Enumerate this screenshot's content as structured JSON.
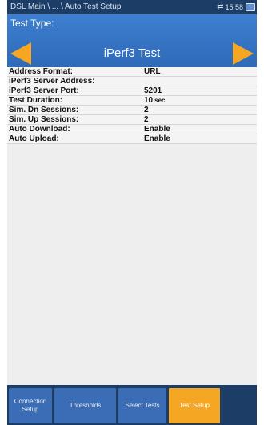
{
  "titlebar": {
    "breadcrumb": "DSL Main \\ ... \\ Auto Test Setup",
    "time": "15:58",
    "icons": [
      "network-arrows-icon",
      "battery-icon"
    ]
  },
  "test_type": {
    "label": "Test Type:",
    "value": "iPerf3 Test"
  },
  "params": [
    {
      "label": "Address Format:",
      "value": "URL",
      "unit": ""
    },
    {
      "label": "iPerf3 Server Address:",
      "value": "",
      "unit": ""
    },
    {
      "label": "iPerf3 Server Port:",
      "value": "5201",
      "unit": ""
    },
    {
      "label": "Test Duration:",
      "value": "10",
      "unit": "sec"
    },
    {
      "label": "Sim. Dn Sessions:",
      "value": "2",
      "unit": ""
    },
    {
      "label": "Sim. Up Sessions:",
      "value": "2",
      "unit": ""
    },
    {
      "label": "Auto Download:",
      "value": "Enable",
      "unit": ""
    },
    {
      "label": "Auto Upload:",
      "value": "Enable",
      "unit": ""
    }
  ],
  "tabs": [
    {
      "label": "Connection Setup",
      "active": false
    },
    {
      "label": "Thresholds",
      "active": false
    },
    {
      "label": "Select Tests",
      "active": false
    },
    {
      "label": "Test Setup",
      "active": true
    }
  ],
  "colors": {
    "titlebar": "#1b3d66",
    "panel": "#3e7fd0",
    "accent": "#f5a623",
    "tab": "#3a6db6"
  }
}
